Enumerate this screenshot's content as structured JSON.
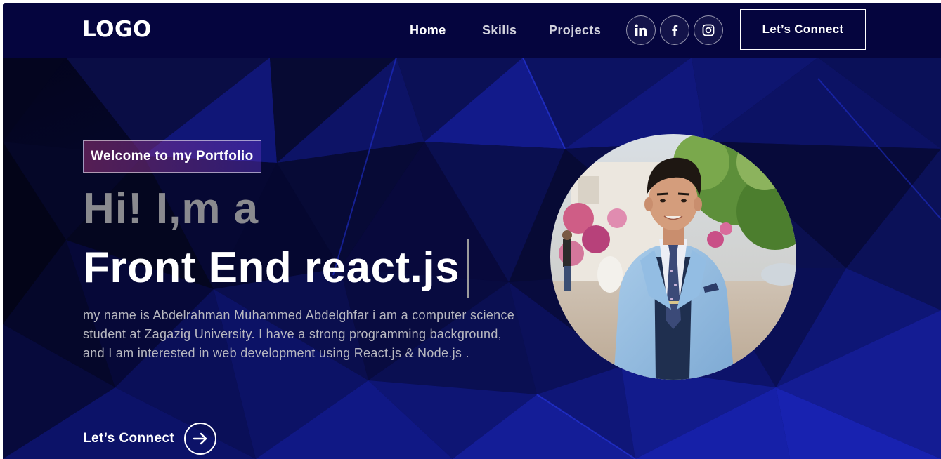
{
  "navbar": {
    "logo": "LOGO",
    "links": {
      "home": "Home",
      "skills": "Skills",
      "projects": "Projects"
    },
    "social": [
      "linkedin-icon",
      "facebook-icon",
      "instagram-icon"
    ],
    "connect_label": "Let’s Connect"
  },
  "hero": {
    "tagline": "Welcome to my Portfolio",
    "greeting": "Hi! I,m a",
    "role": "Front End react.js",
    "bio": "my name is Abdelrahman Muhammed Abdelghfar i am a computer science student at Zagazig University. I have a strong programming background, and I am interested in web development using React.js & Node.js .",
    "cta_label": "Let’s Connect",
    "cta_icon": "arrow-right-circle-icon",
    "photo": "profile-photo"
  },
  "colors": {
    "navbar_bg": "#05053e",
    "hero_bg": "#05062a",
    "accent_blue": "#1a2ad8",
    "greeting_gray": "#8a8a8f",
    "bio_text": "#b8b8c0",
    "tagline_gradient_start": "#aa367c",
    "tagline_gradient_end": "#4a2fbd"
  }
}
